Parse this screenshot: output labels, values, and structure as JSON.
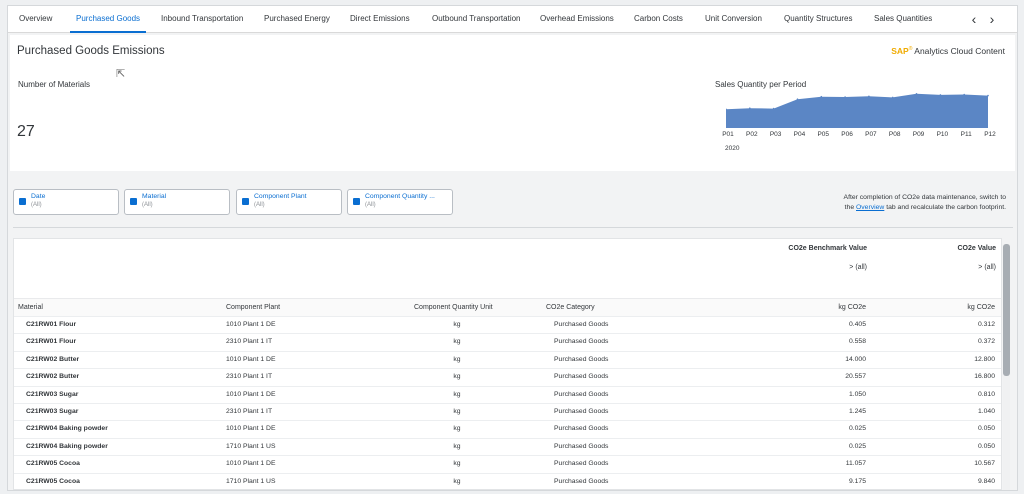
{
  "tabs": [
    {
      "label": "Overview",
      "active": false
    },
    {
      "label": "Purchased Goods",
      "active": true
    },
    {
      "label": "Inbound Transportation",
      "active": false
    },
    {
      "label": "Purchased Energy",
      "active": false
    },
    {
      "label": "Direct Emissions",
      "active": false
    },
    {
      "label": "Outbound Transportation",
      "active": false
    },
    {
      "label": "Overhead Emissions",
      "active": false
    },
    {
      "label": "Carbon Costs",
      "active": false
    },
    {
      "label": "Unit Conversion",
      "active": false
    },
    {
      "label": "Quantity Structures",
      "active": false
    },
    {
      "label": "Sales Quantities",
      "active": false
    }
  ],
  "nav": {
    "prev_glyph": "‹",
    "next_glyph": "›"
  },
  "header": {
    "title": "Purchased Goods Emissions",
    "brand_sap": "SAP",
    "brand_rest": "Analytics Cloud Content",
    "brand_color": "#f0ab00"
  },
  "kpi": {
    "label": "Number of Materials",
    "value": "27"
  },
  "sales_chart": {
    "title": "Sales Quantity per Period",
    "year": "2020",
    "fill_color": "#5b86c5",
    "chart_data": {
      "type": "area",
      "title": "Sales Quantity per Period",
      "categories": [
        "P01",
        "P02",
        "P03",
        "P04",
        "P05",
        "P06",
        "P07",
        "P08",
        "P09",
        "P10",
        "P11",
        "P12"
      ],
      "values": [
        0.52,
        0.55,
        0.54,
        0.8,
        0.87,
        0.86,
        0.88,
        0.85,
        0.95,
        0.92,
        0.93,
        0.9
      ],
      "ylim": [
        0,
        1
      ],
      "ylabel": "",
      "xlabel": "2020",
      "grid": false
    }
  },
  "filters": [
    {
      "name": "Date",
      "value": "(All)"
    },
    {
      "name": "Material",
      "value": "(All)"
    },
    {
      "name": "Component Plant",
      "value": "(All)"
    },
    {
      "name": "Component Quantity ...",
      "value": "(All)"
    }
  ],
  "note": {
    "line1": "After completion of CO2e data maintenance, switch to",
    "prefix": "the",
    "link": "Overview",
    "suffix": "tab and recalculate the carbon footprint."
  },
  "table": {
    "measure_headers": {
      "benchmark": "CO2e Benchmark Value",
      "value": "CO2e Value"
    },
    "all_label": "> (all)",
    "columns": {
      "material": "Material",
      "plant": "Component Plant",
      "unit": "Component Quantity Unit",
      "category": "CO2e Category",
      "bench_unit": "kg CO2e",
      "value_unit": "kg CO2e"
    },
    "rows": [
      {
        "material": "C21RW01 Flour",
        "plant": "1010 Plant 1 DE",
        "unit": "kg",
        "category": "Purchased Goods",
        "bench": "0.405",
        "value": "0.312"
      },
      {
        "material": "C21RW01 Flour",
        "plant": "2310 Plant 1 IT",
        "unit": "kg",
        "category": "Purchased Goods",
        "bench": "0.558",
        "value": "0.372"
      },
      {
        "material": "C21RW02 Butter",
        "plant": "1010 Plant 1 DE",
        "unit": "kg",
        "category": "Purchased Goods",
        "bench": "14.000",
        "value": "12.800"
      },
      {
        "material": "C21RW02 Butter",
        "plant": "2310 Plant 1 IT",
        "unit": "kg",
        "category": "Purchased Goods",
        "bench": "20.557",
        "value": "16.800"
      },
      {
        "material": "C21RW03 Sugar",
        "plant": "1010 Plant 1 DE",
        "unit": "kg",
        "category": "Purchased Goods",
        "bench": "1.050",
        "value": "0.810"
      },
      {
        "material": "C21RW03 Sugar",
        "plant": "2310 Plant 1 IT",
        "unit": "kg",
        "category": "Purchased Goods",
        "bench": "1.245",
        "value": "1.040"
      },
      {
        "material": "C21RW04 Baking powder",
        "plant": "1010 Plant 1 DE",
        "unit": "kg",
        "category": "Purchased Goods",
        "bench": "0.025",
        "value": "0.050"
      },
      {
        "material": "C21RW04 Baking powder",
        "plant": "1710 Plant 1 US",
        "unit": "kg",
        "category": "Purchased Goods",
        "bench": "0.025",
        "value": "0.050"
      },
      {
        "material": "C21RW05 Cocoa",
        "plant": "1010 Plant 1 DE",
        "unit": "kg",
        "category": "Purchased Goods",
        "bench": "11.057",
        "value": "10.567"
      },
      {
        "material": "C21RW05 Cocoa",
        "plant": "1710 Plant 1 US",
        "unit": "kg",
        "category": "Purchased Goods",
        "bench": "9.175",
        "value": "9.840"
      }
    ]
  }
}
